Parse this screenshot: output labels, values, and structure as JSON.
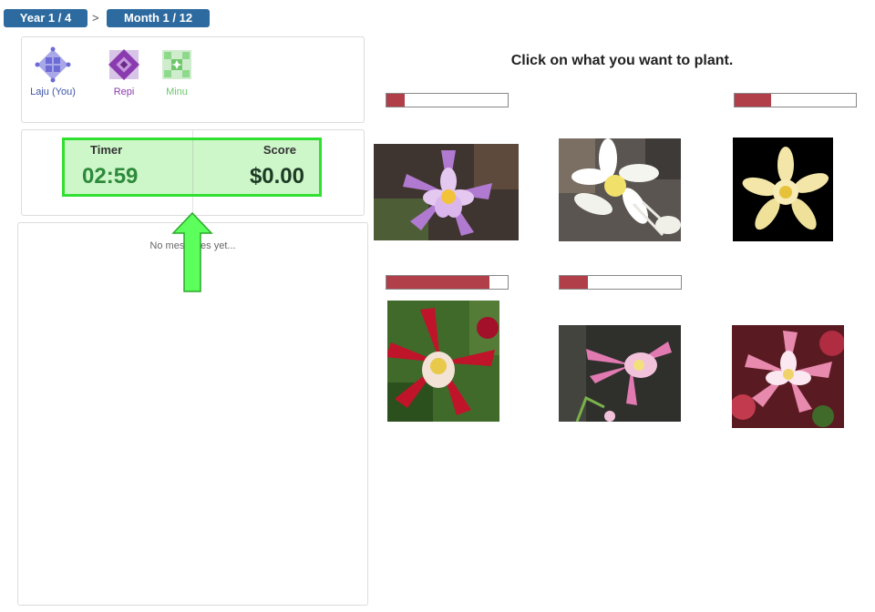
{
  "breadcrumb": {
    "year": "Year 1 / 4",
    "separator": ">",
    "month": "Month 1 / 12",
    "color": "#2d6a9f"
  },
  "players": [
    {
      "name": "Laju (You)",
      "icon": "laju-avatar-icon",
      "color": "#6d6bd6",
      "label_color": "#3d55a8"
    },
    {
      "name": "Repi",
      "icon": "repi-avatar-icon",
      "color": "#8b3bb0",
      "label_color": "#8b3bb0"
    },
    {
      "name": "Minu",
      "icon": "minu-avatar-icon",
      "color": "#6ec76b",
      "label_color": "#6ec76b"
    }
  ],
  "stats": {
    "timer_label": "Timer",
    "timer_value": "02:59",
    "score_label": "Score",
    "score_value": "$0.00"
  },
  "chat": {
    "empty_text": "No messages yet..."
  },
  "instruction": "Click on what you want to plant.",
  "plants": [
    {
      "name": "purple-columbine",
      "progress": 0.15
    },
    {
      "name": "white-columbine",
      "progress": null
    },
    {
      "name": "yellow-columbine",
      "progress": 0.3
    },
    {
      "name": "red-columbine",
      "progress": 0.85
    },
    {
      "name": "pink-columbine",
      "progress": 0.23
    },
    {
      "name": "pink-white-columbine",
      "progress": null
    }
  ],
  "colors": {
    "highlight_fill": "#cdf6c9",
    "highlight_border": "#30e030",
    "progress_fill": "#b03f4a",
    "arrow": "#5cff5c"
  }
}
